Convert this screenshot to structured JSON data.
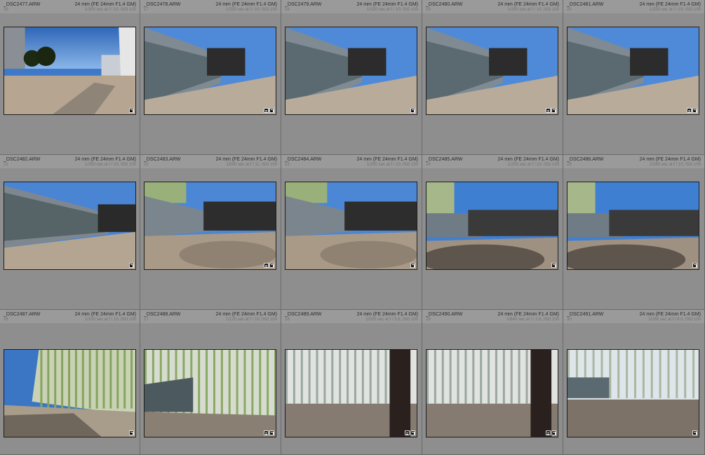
{
  "cells": [
    {
      "file": "_DSC2477.ARW",
      "index": "16",
      "lens": "24 mm (FE 24mm F1.4 GM)",
      "exif": "1/200 sec at f / 10, ISO 100",
      "scene": "plaza",
      "badges": [
        "crop"
      ]
    },
    {
      "file": "_DSC2478.ARW",
      "index": "17",
      "lens": "24 mm (FE 24mm F1.4 GM)",
      "exif": "1/250 sec at f / 10, ISO 100",
      "scene": "wall",
      "badges": [
        "meta",
        "crop"
      ]
    },
    {
      "file": "_DSC2479.ARW",
      "index": "18",
      "lens": "24 mm (FE 24mm F1.4 GM)",
      "exif": "1/320 sec at f / 10, ISO 100",
      "scene": "wall",
      "badges": [
        "crop"
      ]
    },
    {
      "file": "_DSC2480.ARW",
      "index": "19",
      "lens": "24 mm (FE 24mm F1.4 GM)",
      "exif": "1/250 sec at f / 10, ISO 100",
      "scene": "wall",
      "badges": [
        "meta",
        "crop"
      ]
    },
    {
      "file": "_DSC2481.ARW",
      "index": "20",
      "lens": "24 mm (FE 24mm F1.4 GM)",
      "exif": "1/250 sec at f / 10, ISO 100",
      "scene": "wall",
      "badges": [
        "meta",
        "crop"
      ]
    },
    {
      "file": "_DSC2482.ARW",
      "index": "21",
      "lens": "24 mm (FE 24mm F1.4 GM)",
      "exif": "1/250 sec at f / 10, ISO 100",
      "scene": "wall2",
      "badges": [
        "crop"
      ]
    },
    {
      "file": "_DSC2483.ARW",
      "index": "22",
      "lens": "24 mm (FE 24mm F1.4 GM)",
      "exif": "1/500 sec at f / 11, ISO 100",
      "scene": "motion",
      "badges": [
        "meta",
        "crop"
      ]
    },
    {
      "file": "_DSC2484.ARW",
      "index": "23",
      "lens": "24 mm (FE 24mm F1.4 GM)",
      "exif": "1/250 sec at f / 10, ISO 100",
      "scene": "motion",
      "badges": [
        "crop"
      ]
    },
    {
      "file": "_DSC2485.ARW",
      "index": "24",
      "lens": "24 mm (FE 24mm F1.4 GM)",
      "exif": "1/200 sec at f / 10, ISO 100",
      "scene": "dark",
      "badges": [
        "crop"
      ]
    },
    {
      "file": "_DSC2486.ARW",
      "index": "25",
      "lens": "24 mm (FE 24mm F1.4 GM)",
      "exif": "1/160 sec at f / 10, ISO 100",
      "scene": "dark",
      "badges": [
        "crop"
      ]
    },
    {
      "file": "_DSC2487.ARW",
      "index": "26",
      "lens": "24 mm (FE 24mm F1.4 GM)",
      "exif": "1/200 sec at f / 10, ISO 100",
      "scene": "facade_sky",
      "badges": [
        "crop"
      ]
    },
    {
      "file": "_DSC2488.ARW",
      "index": "27",
      "lens": "24 mm (FE 24mm F1.4 GM)",
      "exif": "1/125 sec at f / 10, ISO 100",
      "scene": "facade",
      "badges": [
        "meta",
        "crop"
      ]
    },
    {
      "file": "_DSC2489.ARW",
      "index": "28",
      "lens": "24 mm (FE 24mm F1.4 GM)",
      "exif": "1/320 sec at f / 5.6, ISO 100",
      "scene": "facade_post",
      "badges": [
        "meta",
        "crop"
      ]
    },
    {
      "file": "_DSC2490.ARW",
      "index": "29",
      "lens": "24 mm (FE 24mm F1.4 GM)",
      "exif": "1/640 sec at f / 2.8, ISO 100",
      "scene": "facade_post",
      "badges": [
        "meta",
        "crop"
      ]
    },
    {
      "file": "_DSC2491.ARW",
      "index": "30",
      "lens": "24 mm (FE 24mm F1.4 GM)",
      "exif": "1/160 sec at f / 8.0, ISO 100",
      "scene": "facade_wide",
      "badges": [
        "crop"
      ]
    }
  ]
}
